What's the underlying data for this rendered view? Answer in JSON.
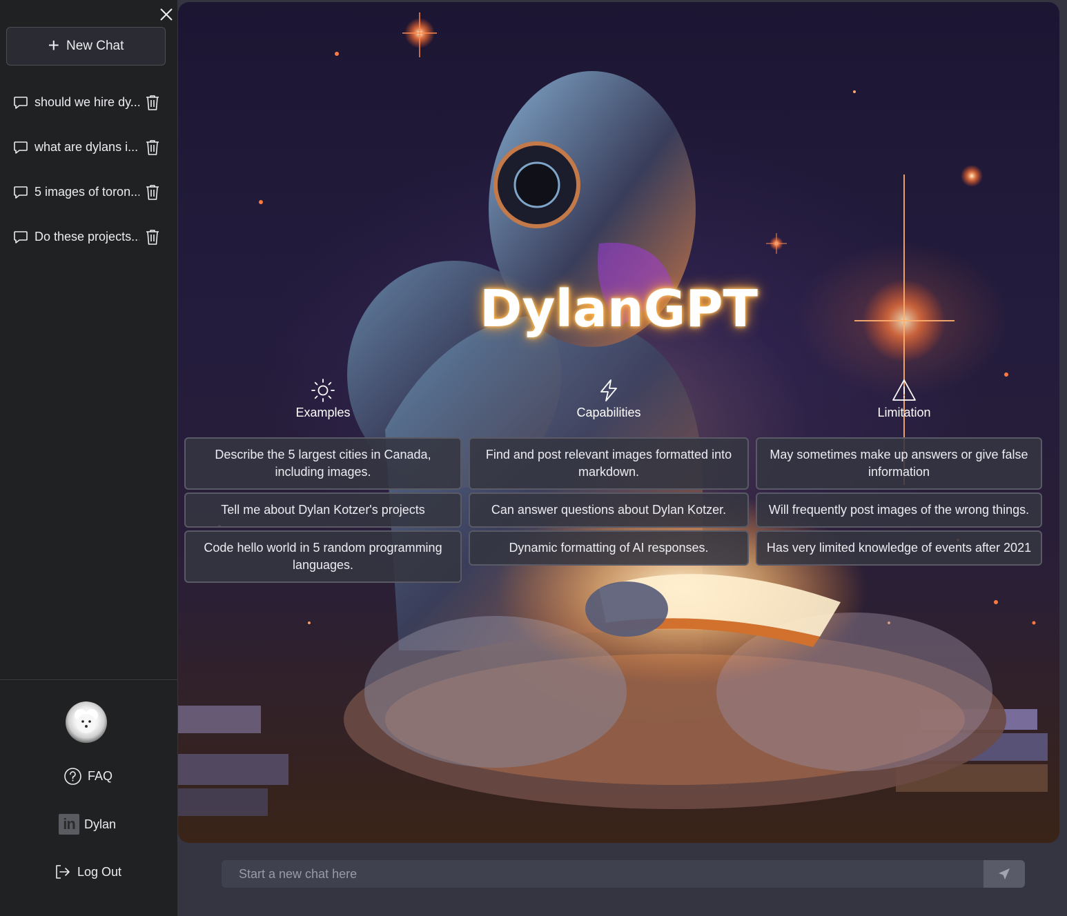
{
  "sidebar": {
    "new_chat_label": "New Chat",
    "chats": [
      {
        "title": "should we hire dy..."
      },
      {
        "title": "what are dylans i..."
      },
      {
        "title": "5 images of toron..."
      },
      {
        "title": "Do these projects..."
      }
    ],
    "faq_label": "FAQ",
    "linkedin_label": "Dylan",
    "logout_label": "Log Out"
  },
  "hero": {
    "brand": "DylanGPT",
    "columns": [
      {
        "heading": "Examples",
        "icon": "sun-icon",
        "items": [
          "Describe the 5 largest cities in Canada, including images.",
          "Tell me about Dylan Kotzer's projects",
          "Code hello world in 5 random programming languages."
        ]
      },
      {
        "heading": "Capabilities",
        "icon": "lightning-icon",
        "items": [
          "Find and post relevant images formatted into markdown.",
          "Can answer questions about Dylan Kotzer.",
          "Dynamic formatting of AI responses."
        ]
      },
      {
        "heading": "Limitation",
        "icon": "warning-triangle-icon",
        "items": [
          "May sometimes make up answers or give false information",
          "Will frequently post images of the wrong things.",
          "Has very limited knowledge of events after 2021"
        ]
      }
    ]
  },
  "input": {
    "placeholder": "Start a new chat here"
  },
  "colors": {
    "sidebar_bg": "#202123",
    "main_bg": "#343541",
    "card_bg": "#343541",
    "input_bg": "#40414f",
    "glow": "#ffb84a"
  }
}
